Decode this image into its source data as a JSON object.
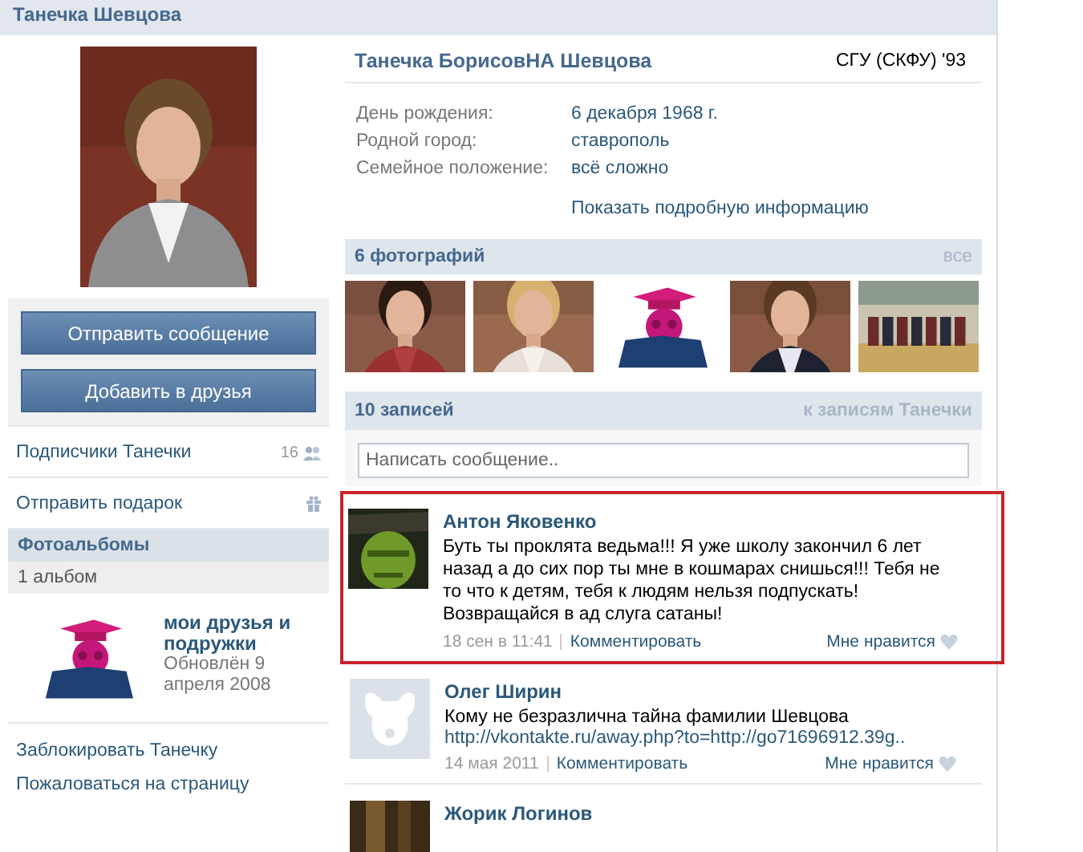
{
  "header": {
    "title": "Танечка Шевцова"
  },
  "sidebar": {
    "buttons": [
      "Отправить сообщение",
      "Добавить в друзья"
    ],
    "links": [
      {
        "kind": "followers",
        "label": "Подписчики Танечки",
        "count": "16"
      },
      {
        "kind": "gift",
        "label": "Отправить подарок"
      }
    ],
    "albums": {
      "title": "Фотоальбомы",
      "count": "1 альбом",
      "items": [
        {
          "title": "мои друзья и подружки",
          "updated": "Обновлён 9 апреля 2008"
        }
      ]
    },
    "actions": [
      "Заблокировать Танечку",
      "Пожаловаться на страницу"
    ]
  },
  "profile": {
    "name": "Танечка БорисовНА Шевцова",
    "education": "СГУ (СКФУ) '93",
    "fields": [
      {
        "label": "День рождения:",
        "value": "6 декабря 1968 г."
      },
      {
        "label": "Родной город:",
        "value": "ставрополь"
      },
      {
        "label": "Семейное положение:",
        "value": "всё сложно"
      }
    ],
    "more_link": "Показать подробную информацию"
  },
  "photos": {
    "title": "6 фотографий",
    "all_link": "все"
  },
  "wall": {
    "title": "10 записей",
    "link": "к записям Танечки",
    "placeholder": "Написать сообщение..",
    "posts": [
      {
        "author": "Антон Яковенко",
        "highlighted": true,
        "text": "Буть ты проклята ведьма!!! Я уже школу закончил 6 лет назад а до сих пор ты мне в кошмарах снишься!!! Тебя не то что к детям, тебя к людям нельзя подпускать! Возвращайся в ад слуга сатаны!",
        "date": "18 сен в 11:41",
        "comment": "Комментировать",
        "like": "Мне нравится"
      },
      {
        "author": "Олег Ширин",
        "avatar": {
          "kind": "default"
        },
        "highlighted": false,
        "text": "Кому не безразлична тайна фамилии Шевцова",
        "link": "http://vkontakte.ru/away.php?to=http://go71696912.39g..",
        "date": "14 мая 2011",
        "comment": "Комментировать",
        "like": "Мне нравится"
      },
      {
        "author": "Жорик Логинов",
        "highlighted": false
      }
    ]
  }
}
